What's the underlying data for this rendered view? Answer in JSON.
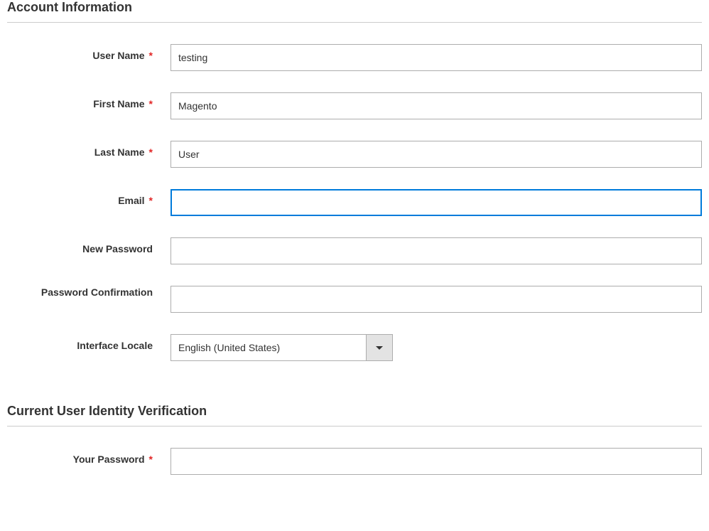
{
  "account_section": {
    "title": "Account Information",
    "fields": {
      "username": {
        "label": "User Name",
        "required": true,
        "value": "testing"
      },
      "firstname": {
        "label": "First Name",
        "required": true,
        "value": "Magento"
      },
      "lastname": {
        "label": "Last Name",
        "required": true,
        "value": "User"
      },
      "email": {
        "label": "Email",
        "required": true,
        "value": ""
      },
      "new_password": {
        "label": "New Password",
        "required": false,
        "value": ""
      },
      "password_confirmation": {
        "label": "Password Confirmation",
        "required": false,
        "value": ""
      },
      "interface_locale": {
        "label": "Interface Locale",
        "required": false,
        "selected": "English (United States)"
      }
    }
  },
  "verification_section": {
    "title": "Current User Identity Verification",
    "fields": {
      "your_password": {
        "label": "Your Password",
        "required": true,
        "value": ""
      }
    }
  },
  "required_mark": "*"
}
